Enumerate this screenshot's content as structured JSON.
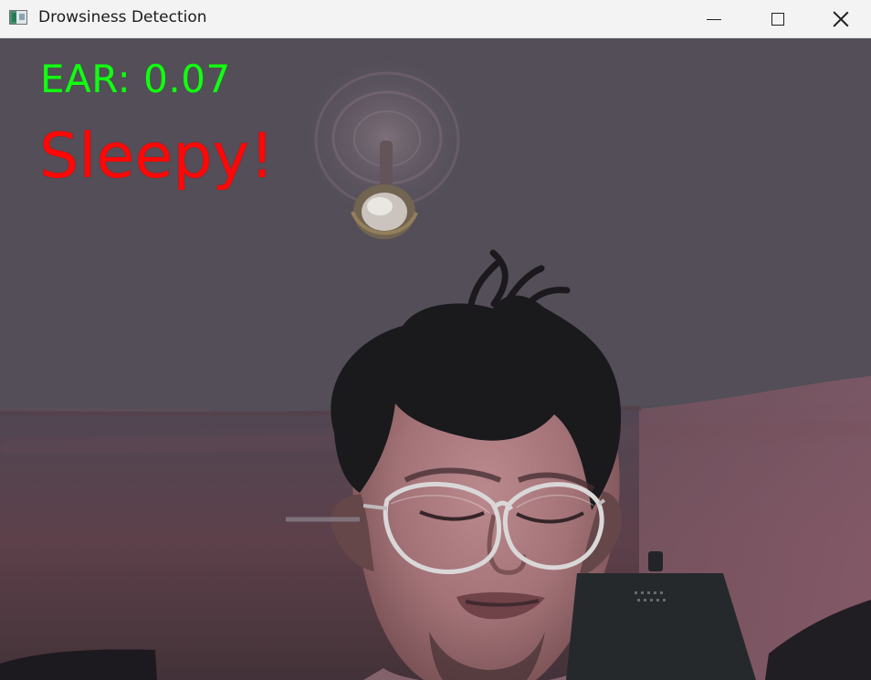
{
  "window": {
    "title": "Drowsiness Detection",
    "icons": {
      "app": "application-icon",
      "minimize": "minimize-icon",
      "maximize": "maximize-icon",
      "close": "close-icon"
    }
  },
  "overlay": {
    "ear_label": "EAR: 0.07",
    "status_label": "Sleepy!",
    "ear_color": "#12ff12",
    "status_color": "#ff0707"
  },
  "camera_feed": {
    "ceiling_fan": "ceiling-fan",
    "person": "person-with-closed-eyes",
    "glasses": "eyeglasses",
    "monitor": "background-monitor"
  }
}
